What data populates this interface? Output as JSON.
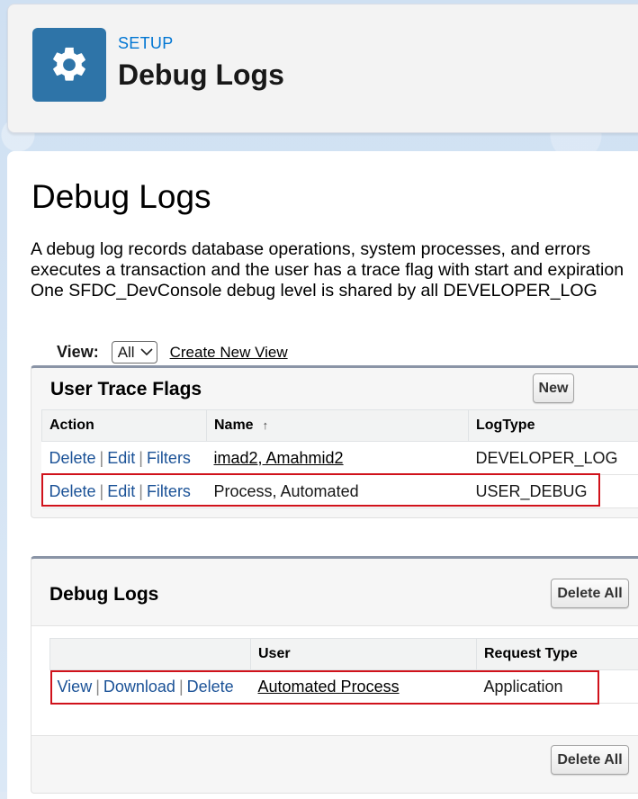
{
  "header": {
    "section": "SETUP",
    "title": "Debug Logs"
  },
  "page": {
    "title": "Debug Logs",
    "description_lines": [
      "A debug log records database operations, system processes, and errors",
      "executes a transaction and the user has a trace flag with start and expiration",
      "One SFDC_DevConsole debug level is shared by all DEVELOPER_LOG"
    ]
  },
  "view": {
    "label": "View:",
    "selected": "All",
    "create_link": "Create New View"
  },
  "trace_flags": {
    "title": "User Trace Flags",
    "new_button": "New",
    "columns": [
      "Action",
      "Name",
      "LogType"
    ],
    "sort_indicator": "↑",
    "action_links": [
      "Delete",
      "Edit",
      "Filters"
    ],
    "rows": [
      {
        "name": "imad2, Amahmid2",
        "log_type": "DEVELOPER_LOG"
      },
      {
        "name": "Process, Automated",
        "log_type": "USER_DEBUG"
      }
    ]
  },
  "debug_logs": {
    "title": "Debug Logs",
    "delete_all_button": "Delete All",
    "columns": [
      "",
      "User",
      "Request Type"
    ],
    "action_links": [
      "View",
      "Download",
      "Delete"
    ],
    "rows": [
      {
        "user": "Automated Process",
        "request_type": "Application"
      }
    ],
    "delete_all_bottom": "Delete All"
  },
  "colors": {
    "brand_icon_bg": "#2e74a8",
    "link": "#1b5297",
    "highlight": "#d0121b",
    "setup_label": "#0176d3"
  },
  "icons": {
    "header": "gear-icon",
    "select": "chevron-down-icon"
  }
}
